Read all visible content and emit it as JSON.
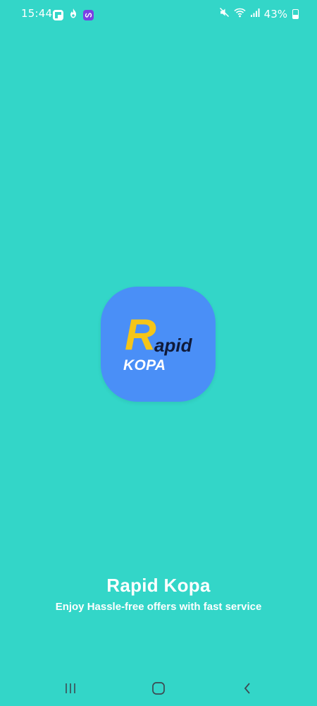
{
  "theme": {
    "background": "#33d6c8",
    "logo_background": "#4a8ff7",
    "logo_accent": "#f5c518",
    "logo_dark": "#0f1a3a",
    "text": "#ffffff"
  },
  "status_bar": {
    "time": "15:44",
    "battery_percent": "43%",
    "notification_icons": [
      "flipboard-icon",
      "fire-icon",
      "app-icon"
    ],
    "right_icons": [
      "mute-icon",
      "wifi-icon",
      "signal-icon",
      "battery-icon"
    ]
  },
  "logo": {
    "letter_r": "R",
    "letters_apid": "apid",
    "word_kopa": "KOPA"
  },
  "splash": {
    "title": "Rapid Kopa",
    "tagline": "Enjoy Hassle-free offers with fast service"
  },
  "nav_bar": {
    "buttons": [
      "recent-apps-icon",
      "home-icon",
      "back-icon"
    ]
  }
}
